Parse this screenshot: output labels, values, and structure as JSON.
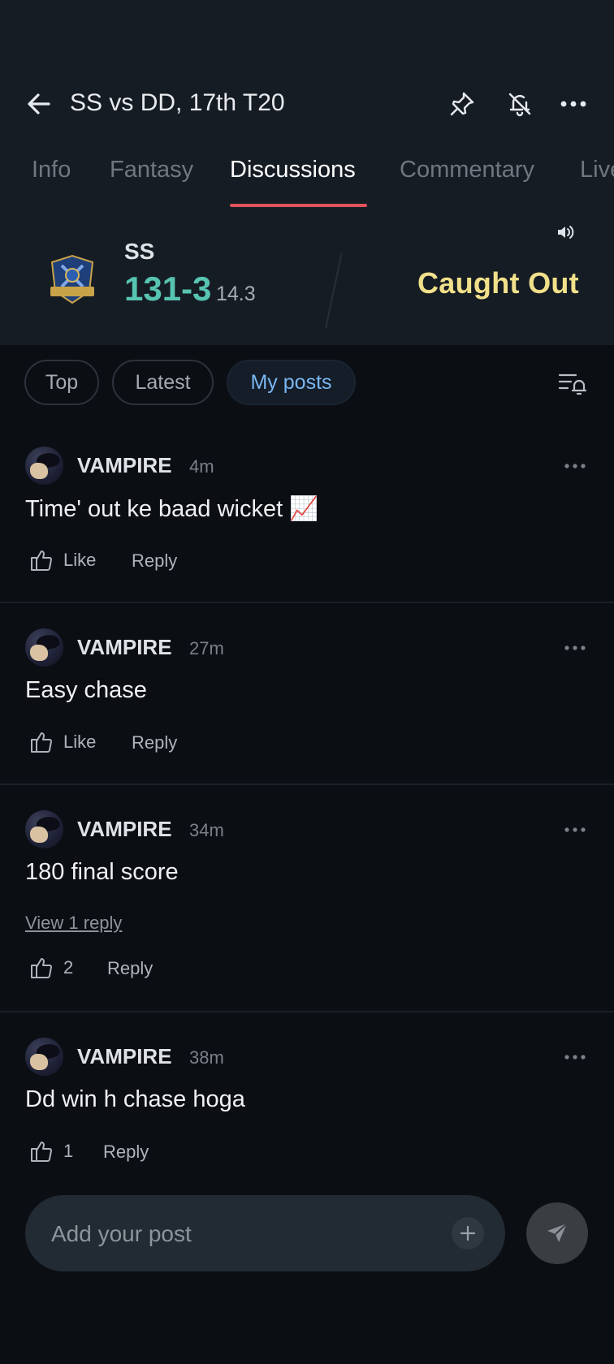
{
  "header": {
    "title": "SS vs DD, 17th T20",
    "tabs": [
      {
        "label": "Info"
      },
      {
        "label": "Fantasy"
      },
      {
        "label": "Discussions"
      },
      {
        "label": "Commentary"
      },
      {
        "label": "Live"
      }
    ],
    "active_tab": "Discussions",
    "icons": [
      "back-arrow-icon",
      "pin-icon",
      "bell-off-icon",
      "more-icon"
    ]
  },
  "scorecard": {
    "team": "SS",
    "logo_text": "SANTHAL",
    "score": "131-3",
    "overs": "14.3",
    "event": "Caught Out"
  },
  "filters": {
    "chips": [
      "Top",
      "Latest",
      "My posts"
    ],
    "active": "My posts"
  },
  "posts": [
    {
      "user": "VAMPIRE",
      "time": "4m",
      "text": "Time' out ke baad wicket 📈",
      "like_label": "Like",
      "reply_label": "Reply"
    },
    {
      "user": "VAMPIRE",
      "time": "27m",
      "text": "Easy chase",
      "like_label": "Like",
      "reply_label": "Reply"
    },
    {
      "user": "VAMPIRE",
      "time": "34m",
      "text": "180 final score",
      "view_replies": "View 1 reply",
      "like_label": "2",
      "reply_label": "Reply"
    },
    {
      "user": "VAMPIRE",
      "time": "38m",
      "text": "Dd win h chase hoga",
      "like_label": "1",
      "reply_label": "Reply"
    }
  ],
  "composer": {
    "placeholder": "Add your post"
  },
  "colors": {
    "background": "#0b0e13",
    "header_bg": "#161c24",
    "accent_tab": "#e0525a",
    "score": "#57c4b1",
    "event": "#f1e08a",
    "active_chip": "#7ab7f2"
  }
}
